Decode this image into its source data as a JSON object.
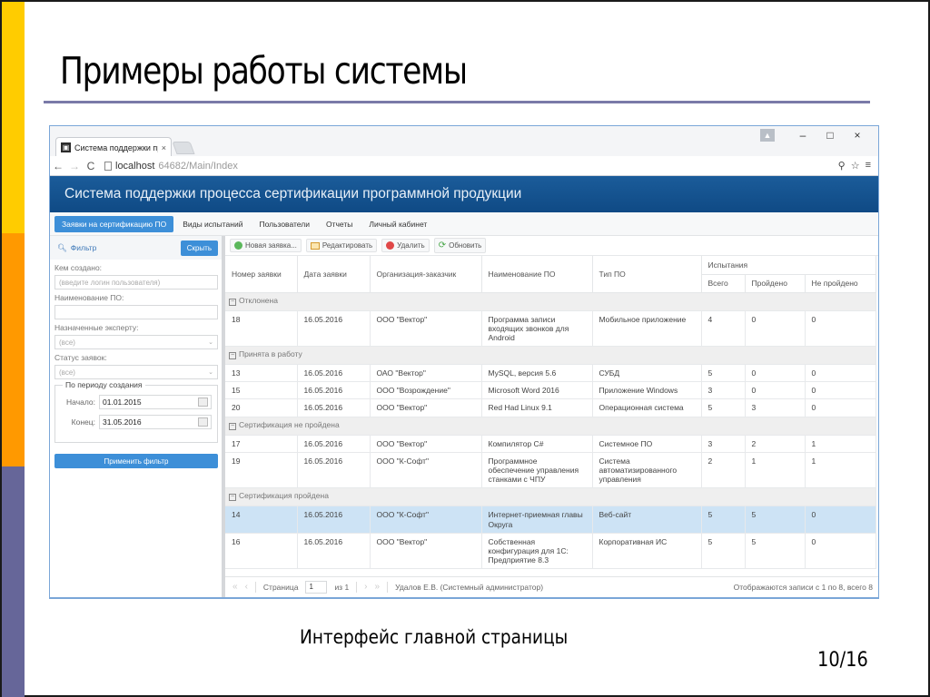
{
  "slide": {
    "title": "Примеры работы системы",
    "caption": "Интерфейс главной страницы",
    "page_number": "10/16",
    "colors": {
      "strip_top": "#ffcc00",
      "strip_mid": "#ff9900",
      "strip_bottom": "#666699",
      "title_rule": "#7a7aa8"
    }
  },
  "browser": {
    "tab_title": "Система поддержки про",
    "tab_close": "×",
    "address_host": "localhost",
    "address_path": "64682/Main/Index",
    "icons": {
      "back": "←",
      "forward": "→",
      "reload": "C",
      "key": "⚲",
      "star": "☆",
      "menu": "≡"
    },
    "window": {
      "minimize": "–",
      "maximize": "□",
      "close": "×",
      "user": "▲"
    }
  },
  "app": {
    "title": "Система поддержки процесса сертификации программной продукции",
    "accent": "#3d8fd8",
    "header_color": "#1b5c9a",
    "nav": [
      {
        "label": "Заявки на сертификацию ПО",
        "active": true
      },
      {
        "label": "Виды испытаний",
        "active": false
      },
      {
        "label": "Пользователи",
        "active": false
      },
      {
        "label": "Отчеты",
        "active": false
      },
      {
        "label": "Личный кабинет",
        "active": false
      }
    ]
  },
  "filter": {
    "title": "Фильтр",
    "hide_label": "Скрыть",
    "created_by_label": "Кем создано:",
    "created_by_placeholder": "(введите логин пользователя)",
    "software_name_label": "Наименование ПО:",
    "software_name_value": "",
    "expert_label": "Назначенные эксперту:",
    "expert_value": "(все)",
    "status_label": "Статус заявок:",
    "status_value": "(все)",
    "period_legend": "По периоду создания",
    "start_label": "Начало:",
    "start_value": "01.01.2015",
    "end_label": "Конец:",
    "end_value": "31.05.2016",
    "apply_label": "Применить фильтр"
  },
  "toolbar": {
    "new_label": "Новая заявка...",
    "edit_label": "Редактировать",
    "delete_label": "Удалить",
    "refresh_label": "Обновить"
  },
  "grid": {
    "headers": {
      "number": "Номер заявки",
      "date": "Дата заявки",
      "org": "Организация-заказчик",
      "name": "Наименование ПО",
      "type": "Тип ПО",
      "tests": "Испытания",
      "total": "Всего",
      "passed": "Пройдено",
      "failed": "Не пройдено"
    },
    "groups": [
      {
        "label": "Отклонена",
        "rows": [
          {
            "number": "18",
            "date": "16.05.2016",
            "org": "ООО \"Вектор\"",
            "name": "Программа записи входящих звонков для Android",
            "type": "Мобильное приложение",
            "total": "4",
            "passed": "0",
            "failed": "0",
            "selected": false
          }
        ]
      },
      {
        "label": "Принята в работу",
        "rows": [
          {
            "number": "13",
            "date": "16.05.2016",
            "org": "ОАО \"Вектор\"",
            "name": "MySQL, версия 5.6",
            "type": "СУБД",
            "total": "5",
            "passed": "0",
            "failed": "0",
            "selected": false
          },
          {
            "number": "15",
            "date": "16.05.2016",
            "org": "ООО \"Возрождение\"",
            "name": "Microsoft Word 2016",
            "type": "Приложение Windows",
            "total": "3",
            "passed": "0",
            "failed": "0",
            "selected": false
          },
          {
            "number": "20",
            "date": "16.05.2016",
            "org": "ООО \"Вектор\"",
            "name": "Red Had Linux 9.1",
            "type": "Операционная система",
            "total": "5",
            "passed": "3",
            "failed": "0",
            "selected": false
          }
        ]
      },
      {
        "label": "Сертификация не пройдена",
        "rows": [
          {
            "number": "17",
            "date": "16.05.2016",
            "org": "ООО \"Вектор\"",
            "name": "Компилятор C#",
            "type": "Системное ПО",
            "total": "3",
            "passed": "2",
            "failed": "1",
            "selected": false
          },
          {
            "number": "19",
            "date": "16.05.2016",
            "org": "ООО \"К-Софт\"",
            "name": "Программное обеспечение управления станками с ЧПУ",
            "type": "Система автоматизированного управления",
            "total": "2",
            "passed": "1",
            "failed": "1",
            "selected": false
          }
        ]
      },
      {
        "label": "Сертификация пройдена",
        "rows": [
          {
            "number": "14",
            "date": "16.05.2016",
            "org": "ООО \"К-Софт\"",
            "name": "Интернет-приемная главы Округа",
            "type": "Веб-сайт",
            "total": "5",
            "passed": "5",
            "failed": "0",
            "selected": true
          },
          {
            "number": "16",
            "date": "16.05.2016",
            "org": "ООО \"Вектор\"",
            "name": "Собственная конфигурация для 1С: Предприятие 8.3",
            "type": "Корпоративная ИС",
            "total": "5",
            "passed": "5",
            "failed": "0",
            "selected": false
          }
        ]
      }
    ]
  },
  "pager": {
    "first": "«",
    "prev": "‹",
    "next": "›",
    "last": "»",
    "page_label": "Страница",
    "page_value": "1",
    "of_label": "из 1",
    "user": "Удалов Е.В. (Системный администратор)",
    "info": "Отображаются записи с 1 по 8, всего 8"
  }
}
